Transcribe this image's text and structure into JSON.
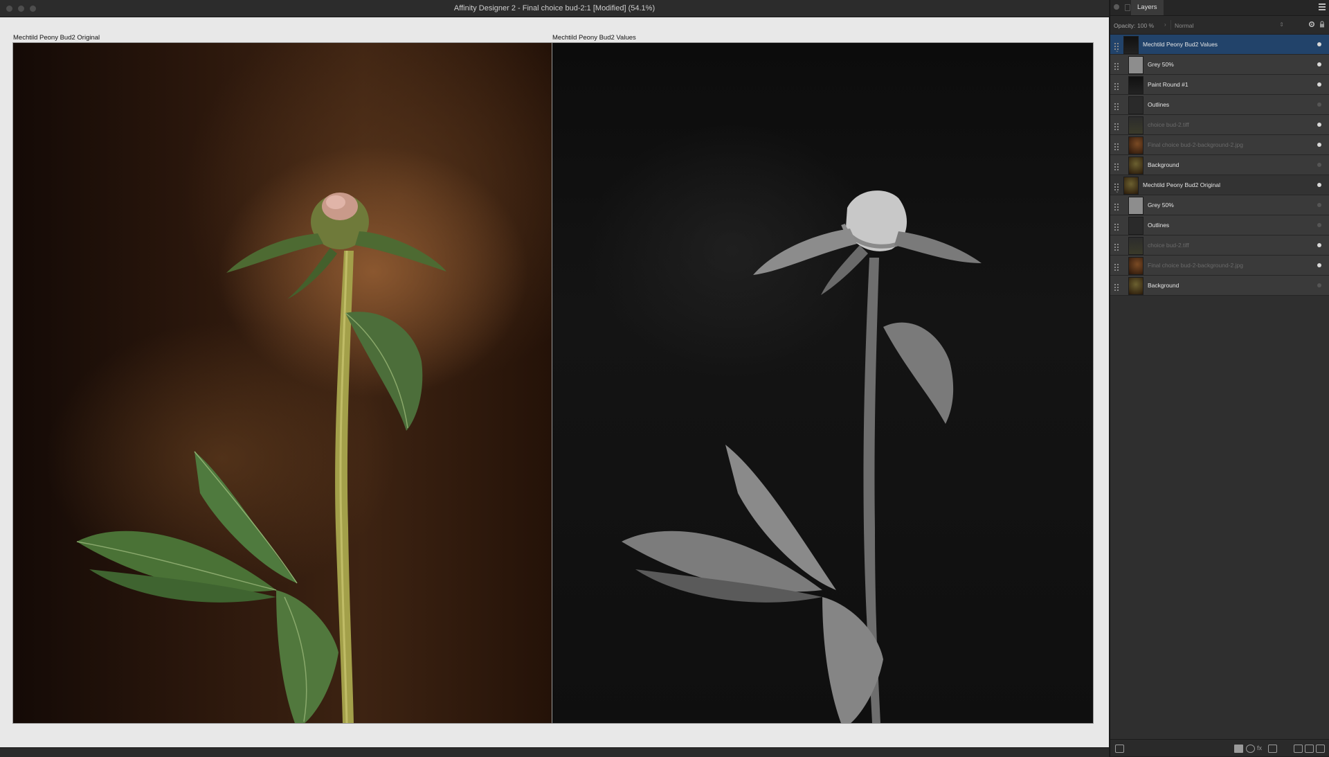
{
  "window": {
    "title": "Affinity Designer 2 - Final choice bud-2:1 [Modified] (54.1%)"
  },
  "canvas": {
    "artboards": [
      {
        "label": "Mechtild Peony Bud2 Original"
      },
      {
        "label": "Mechtild Peony Bud2 Values"
      }
    ]
  },
  "layers_panel": {
    "tab": "Layers",
    "opacity_label": "Opacity:",
    "opacity_value": "100 %",
    "blend_mode": "Normal",
    "layers": [
      {
        "name": "Mechtild Peony Bud2 Values",
        "kind": "parent",
        "selected": true,
        "visible": true,
        "thumb": "dark-stem"
      },
      {
        "name": "Grey 50%",
        "kind": "child",
        "visible": true,
        "thumb": "grey"
      },
      {
        "name": "Paint Round #1",
        "kind": "child",
        "visible": true,
        "thumb": "dark-stem"
      },
      {
        "name": "Outlines",
        "kind": "child",
        "visible": false,
        "thumb": "dark"
      },
      {
        "name": "choice bud-2.tiff",
        "kind": "child",
        "visible": true,
        "hidden_style": true,
        "thumb": "dim-stem"
      },
      {
        "name": "Final choice bud-2-background-2.jpg",
        "kind": "child",
        "visible": true,
        "hidden_style": true,
        "thumb": "brown"
      },
      {
        "name": "Background",
        "kind": "child",
        "visible": false,
        "thumb": "flower"
      },
      {
        "name": "Mechtild Peony Bud2 Original",
        "kind": "parent",
        "visible": true,
        "thumb": "flower"
      },
      {
        "name": "Grey 50%",
        "kind": "child",
        "visible": false,
        "thumb": "grey"
      },
      {
        "name": "Outlines",
        "kind": "child",
        "visible": false,
        "thumb": "dark"
      },
      {
        "name": "choice bud-2.tiff",
        "kind": "child",
        "visible": true,
        "hidden_style": true,
        "thumb": "dim-stem"
      },
      {
        "name": "Final choice bud-2-background-2.jpg",
        "kind": "child",
        "visible": true,
        "hidden_style": true,
        "thumb": "brown"
      },
      {
        "name": "Background",
        "kind": "child",
        "visible": false,
        "thumb": "flower"
      }
    ]
  },
  "colors": {
    "selection": "#22436a",
    "panel": "#2f2f2f",
    "canvas_bg": "#e8e8e8"
  }
}
